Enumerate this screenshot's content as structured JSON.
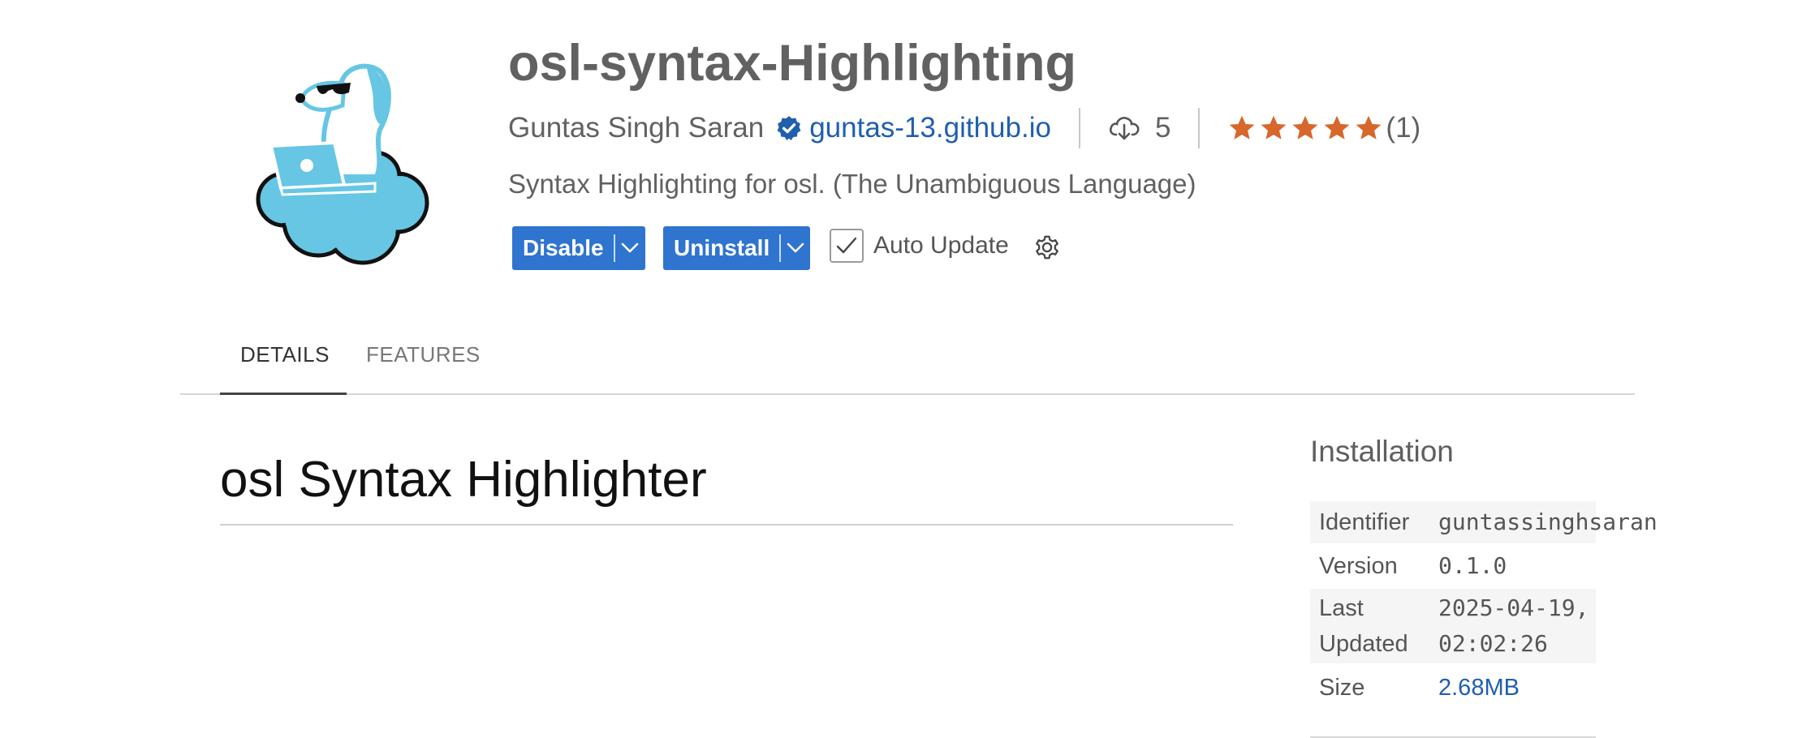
{
  "extension": {
    "name": "osl-syntax-Highlighting",
    "publisher": "Guntas Singh Saran",
    "website": "guntas-13.github.io",
    "installs": "5",
    "rating_stars": 5,
    "rating_count": "(1)",
    "description": "Syntax Highlighting for osl. (The Unambiguous Language)"
  },
  "actions": {
    "disable_label": "Disable",
    "uninstall_label": "Uninstall",
    "auto_update_label": "Auto Update",
    "auto_update_checked": true
  },
  "tabs": [
    {
      "label": "DETAILS",
      "active": true
    },
    {
      "label": "FEATURES",
      "active": false
    }
  ],
  "readme": {
    "heading": "osl Syntax Highlighter"
  },
  "installation": {
    "heading": "Installation",
    "identifier_label": "Identifier",
    "identifier_value": "guntassinghsaran",
    "version_label": "Version",
    "version_value": "0.1.0",
    "last_updated_label_1": "Last",
    "last_updated_label_2": "Updated",
    "last_updated_value_1": "2025-04-19,",
    "last_updated_value_2": "02:02:26",
    "size_label": "Size",
    "size_value": "2.68MB"
  },
  "colors": {
    "accent_button": "#2f74cf",
    "link": "#1f5fad",
    "star": "#d7672b",
    "logo_blue": "#66c6e4"
  },
  "icons": [
    "verified-badge-icon",
    "cloud-download-icon",
    "star-icon",
    "chevron-down-icon",
    "checkmark-icon",
    "gear-icon"
  ]
}
